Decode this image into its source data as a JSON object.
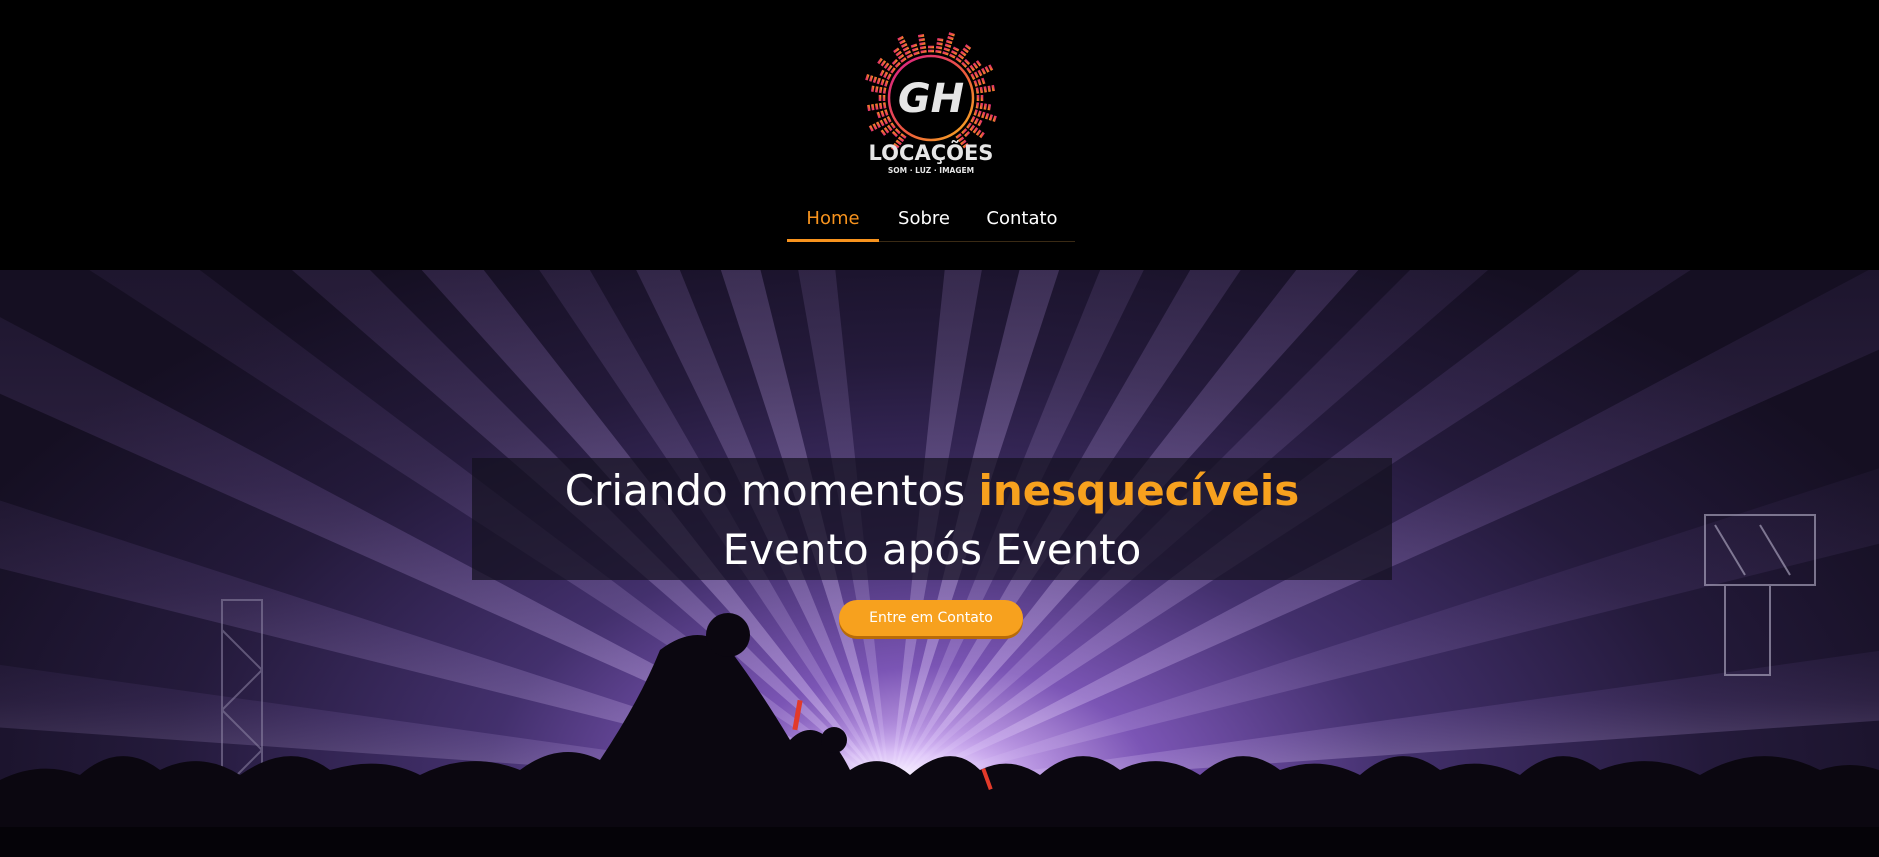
{
  "brand": {
    "logo_monogram": "GH",
    "logo_name": "LOCAÇÕES",
    "logo_tagline": "SOM · LUZ · IMAGEM"
  },
  "nav": {
    "items": [
      {
        "label": "Home",
        "active": true
      },
      {
        "label": "Sobre",
        "active": false
      },
      {
        "label": "Contato",
        "active": false
      }
    ]
  },
  "hero": {
    "headline_prefix": "Criando momentos ",
    "headline_highlight": "inesquecíveis",
    "headline_line2": "Evento após Evento",
    "cta_label": "Entre em Contato"
  },
  "colors": {
    "accent": "#f7931e",
    "header_bg": "#000000",
    "logo_gradient": [
      "#d81b8c",
      "#f7a11e"
    ]
  }
}
